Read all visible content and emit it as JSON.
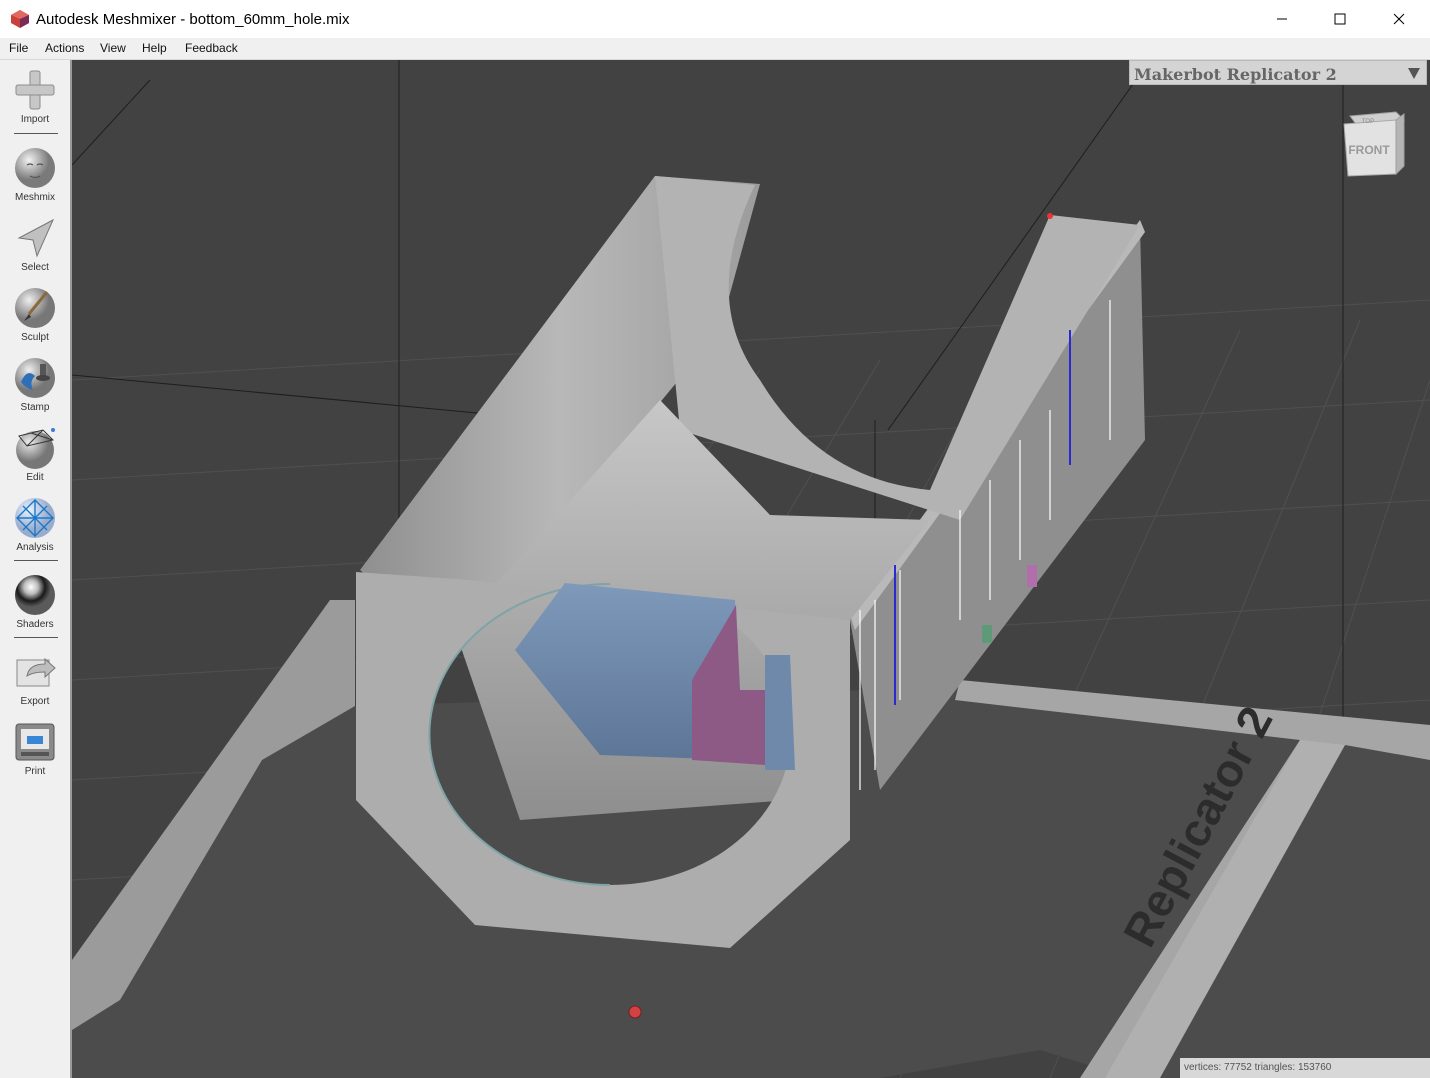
{
  "window": {
    "title": "Autodesk Meshmixer - bottom_60mm_hole.mix",
    "controls": {
      "minimize": "minimize",
      "maximize": "maximize",
      "close": "close"
    }
  },
  "menu": {
    "file": "File",
    "actions": "Actions",
    "view": "View",
    "help": "Help",
    "feedback": "Feedback"
  },
  "toolbar": {
    "import": "Import",
    "meshmix": "Meshmix",
    "select": "Select",
    "sculpt": "Sculpt",
    "stamp": "Stamp",
    "edit": "Edit",
    "analysis": "Analysis",
    "shaders": "Shaders",
    "export": "Export",
    "print": "Print"
  },
  "printer": {
    "selected": "Makerbot Replicator 2",
    "bed_label": "Replicator 2"
  },
  "view_cube": {
    "face": "FRONT",
    "top_face": "TOP"
  },
  "stats": {
    "text": "vertices: 77752 triangles: 153760"
  },
  "colors": {
    "viewport_bg": "#424242",
    "model": "#b0b0b0",
    "blue_part": "#6f89ab",
    "magenta_part": "#8d5a86"
  }
}
